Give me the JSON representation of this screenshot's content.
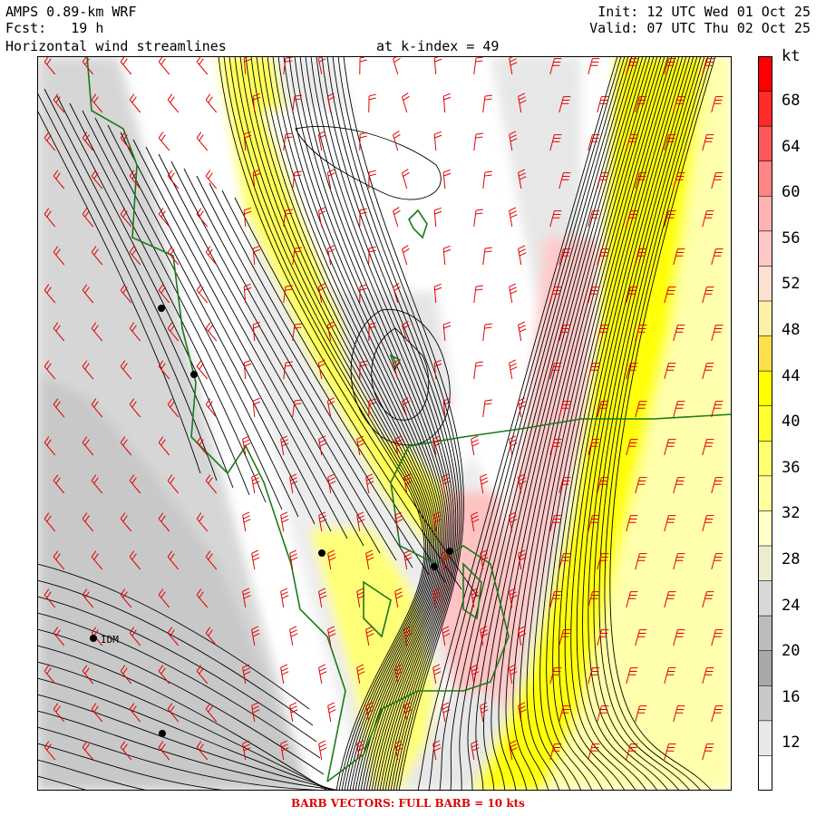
{
  "header": {
    "model": "AMPS 0.89-km WRF",
    "forecast": "Fcst:   19 h",
    "field": "Horizontal wind streamlines",
    "level": "at k-index = 49",
    "init": "Init: 12 UTC Wed 01 Oct 25",
    "valid": "Valid: 07 UTC Thu 02 Oct 25"
  },
  "colorbar": {
    "unit": "kt",
    "labels": [
      "68",
      "64",
      "60",
      "56",
      "52",
      "48",
      "44",
      "40",
      "36",
      "32",
      "28",
      "24",
      "20",
      "16",
      "12"
    ],
    "colors": [
      "#ff0000",
      "#ff2a2a",
      "#ff5858",
      "#ff8585",
      "#ffb2b2",
      "#ffc8c8",
      "#ffe0d0",
      "#fff0a8",
      "#ffe04a",
      "#ffff00",
      "#ffff30",
      "#ffff70",
      "#ffffa0",
      "#ffffc8",
      "#ececd0",
      "#d8d8d8",
      "#bcbcbc",
      "#a8a8a8",
      "#c8c8c8",
      "#e8e8e8",
      "#ffffff"
    ]
  },
  "station_label": "IDM",
  "footer": "BARB VECTORS:  FULL BARB = 10 kts",
  "colors": {
    "coast": "#1a7a1a",
    "barb": "#e00000",
    "stream": "#000000"
  }
}
